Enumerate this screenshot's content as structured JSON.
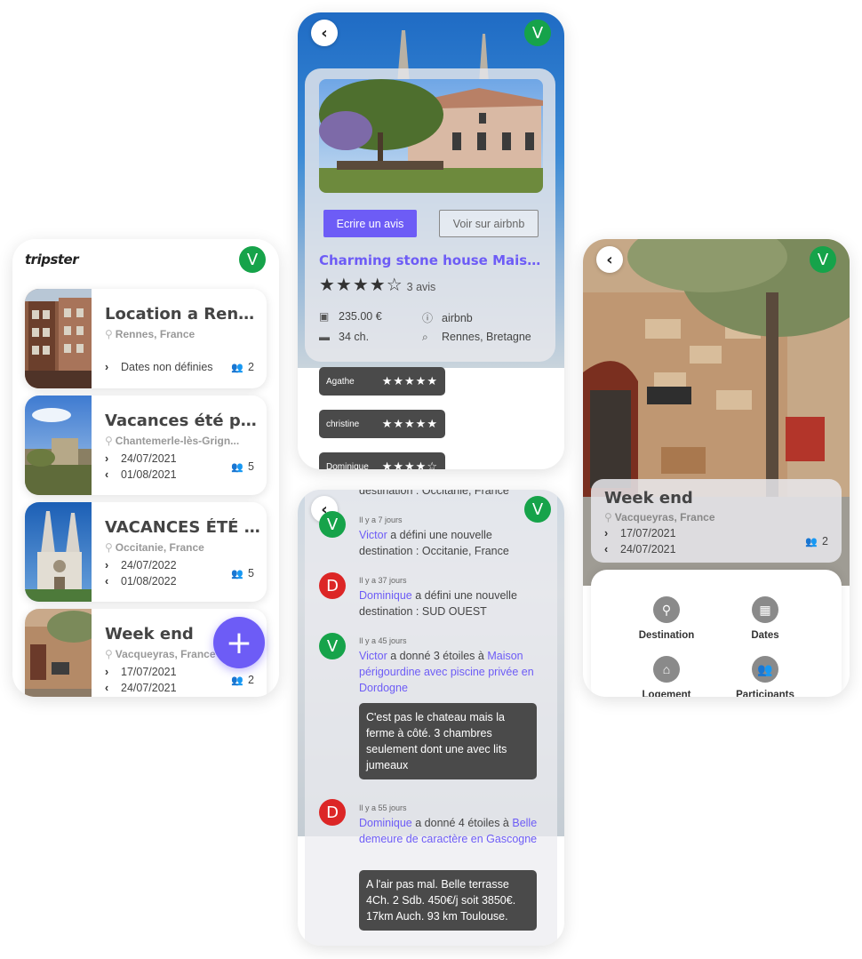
{
  "avatar_letter": "V",
  "list_screen": {
    "brand": "tripster",
    "avatar": "V",
    "trips": [
      {
        "title": "Location a Rennes",
        "location": "Rennes, France",
        "dates_label": "Dates non définies",
        "participants": "2"
      },
      {
        "title": "Vacances été pa...",
        "location": "Chantemerle-lès-Grign...",
        "start": "24/07/2021",
        "end": "01/08/2021",
        "participants": "5"
      },
      {
        "title": "VACANCES ÉTÉ 2...",
        "location": "Occitanie, France",
        "start": "24/07/2022",
        "end": "01/08/2022",
        "participants": "5"
      },
      {
        "title": "Week end",
        "location": "Vacqueyras, France",
        "start": "17/07/2021",
        "end": "24/07/2021",
        "participants": "2"
      }
    ],
    "fab_label": "+"
  },
  "detail_screen": {
    "avatar": "V",
    "review_button": "Ecrire un avis",
    "airbnb_button": "Voir sur airbnb",
    "title": "Charming stone house Maison g...",
    "stars": "★★★★☆",
    "review_count": "3 avis",
    "price": "235.00 €",
    "source": "airbnb",
    "rooms": "34 ch.",
    "place": "Rennes, Bretagne",
    "reviews": [
      {
        "name": "Agathe",
        "stars": "★★★★★"
      },
      {
        "name": "christine",
        "stars": "★★★★★"
      },
      {
        "name": "Dominique",
        "stars": "★★★★☆"
      }
    ]
  },
  "activity_screen": {
    "avatar": "V",
    "cut_text": "destination : Occitanie, France",
    "items": [
      {
        "initial": "V",
        "time": "Il y a 7 jours",
        "user": "Victor",
        "text": " a défini une nouvelle destination : Occitanie, France"
      },
      {
        "initial": "D",
        "time": "Il y a 37 jours",
        "user": "Dominique",
        "text": " a défini une nouvelle destination : SUD OUEST"
      },
      {
        "initial": "V",
        "time": "Il y a 45 jours",
        "user": "Victor",
        "text": " a donné 3 étoiles à ",
        "link": "Maison périgourdine avec piscine privée en Dordogne",
        "comment": "C'est pas le chateau mais la ferme à côté. 3 chambres seulement dont une avec lits jumeaux"
      },
      {
        "initial": "D",
        "time": "Il y a 55 jours",
        "user": "Dominique",
        "text": " a donné 4 étoiles à ",
        "link": "Belle demeure de caractère en Gascogne",
        "comment": "A l'air pas mal. Belle terrasse 4Ch. 2 Sdb. 450€/j soit 3850€. 17km Auch. 93 km Toulouse."
      }
    ]
  },
  "trip_screen": {
    "avatar": "V",
    "title": "Week end",
    "location": "Vacqueyras, France",
    "start": "17/07/2021",
    "end": "24/07/2021",
    "participants": "2",
    "tiles": [
      "Destination",
      "Dates",
      "Logement",
      "Participants"
    ]
  },
  "colors": {
    "accent": "#6d5cf6",
    "avatar_green": "#16a34a",
    "avatar_red": "#dc2626",
    "dark_chip": "#4a4a4a"
  }
}
